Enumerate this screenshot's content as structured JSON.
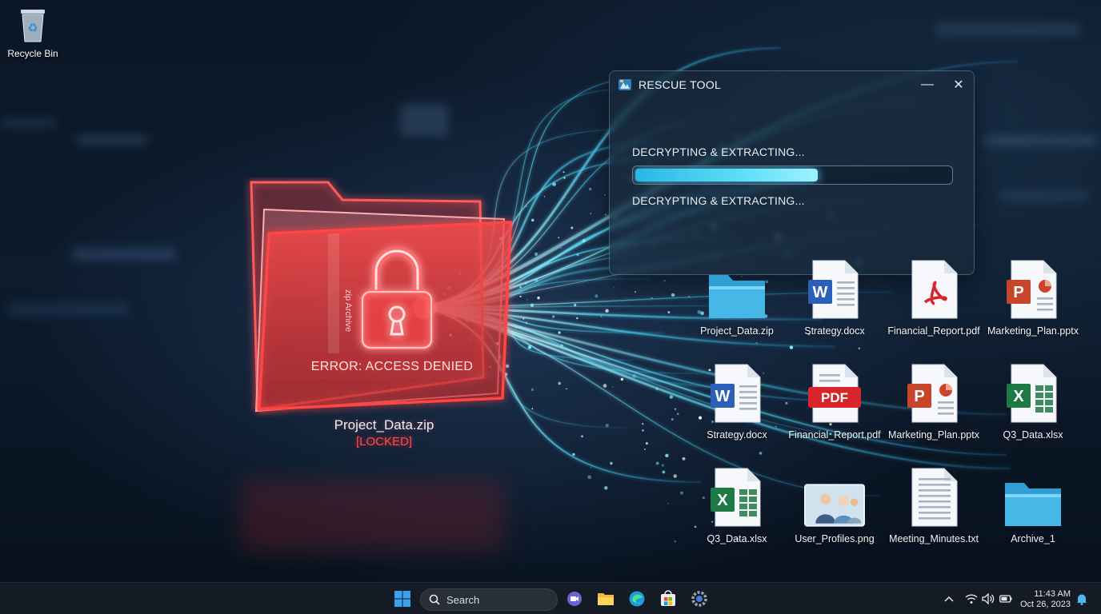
{
  "desktop": {
    "recycle_bin_label": "Recycle Bin"
  },
  "locked_archive": {
    "name": "Project_Data.zip",
    "state": "[LOCKED]",
    "error": "ERROR: ACCESS DENIED",
    "tab_text": "zip Archive",
    "icon": "padlock-icon",
    "color": "#ff3b3b"
  },
  "rescue_window": {
    "title": "RESCUE TOOL",
    "status_top": "DECRYPTING & EXTRACTING...",
    "status_bottom": "DECRYPTING & EXTRACTING...",
    "progress_percent": 58,
    "minimize_glyph": "—",
    "close_glyph": "✕",
    "accent": "#4fd8f5"
  },
  "files": [
    {
      "label": "Project_Data.zip",
      "icon": "folder-icon"
    },
    {
      "label": "Strategy.docx",
      "icon": "word-icon"
    },
    {
      "label": "Financial_Report.pdf",
      "icon": "pdf-icon"
    },
    {
      "label": "Marketing_Plan.pptx",
      "icon": "powerpoint-icon"
    },
    {
      "label": "Strategy.docx",
      "icon": "word-icon"
    },
    {
      "label": "Financial_Report.pdf",
      "icon": "pdf-badge-icon",
      "badge": "PDF"
    },
    {
      "label": "Marketing_Plan.pptx",
      "icon": "powerpoint-icon"
    },
    {
      "label": "Q3_Data.xlsx",
      "icon": "excel-icon"
    },
    {
      "label": "Q3_Data.xlsx",
      "icon": "excel-icon"
    },
    {
      "label": "User_Profiles.png",
      "icon": "image-icon"
    },
    {
      "label": "Meeting_Minutes.txt",
      "icon": "text-file-icon"
    },
    {
      "label": "Archive_1",
      "icon": "folder-icon"
    }
  ],
  "icon_letters": {
    "word": "W",
    "excel": "X",
    "powerpoint": "P"
  },
  "taskbar": {
    "search_label": "Search",
    "time": "11:43 AM",
    "date": "Oct 26, 2023",
    "apps": [
      "start-icon",
      "meet-icon",
      "file-explorer-icon",
      "edge-icon",
      "store-icon",
      "settings-icon"
    ],
    "tray": [
      "chevron-up-icon",
      "wifi-icon",
      "volume-icon",
      "battery-icon",
      "notification-bell-icon"
    ]
  },
  "colors": {
    "word": "#2b5fb8",
    "excel": "#1e7a45",
    "powerpoint": "#c9452a",
    "pdf": "#d8242b",
    "folder": "#45b8e8"
  }
}
